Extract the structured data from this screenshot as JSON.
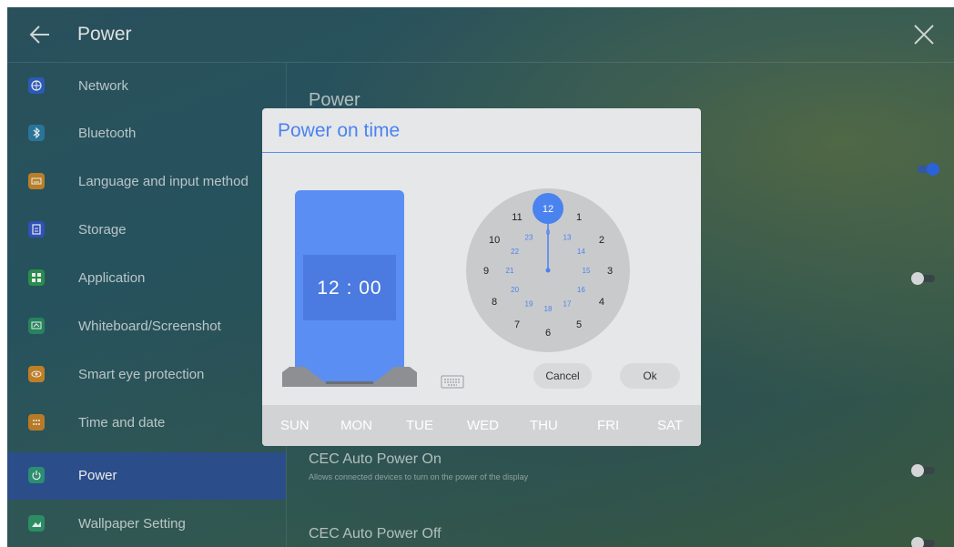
{
  "header": {
    "title": "Power",
    "back_icon": "back-arrow-icon",
    "close_icon": "close-icon"
  },
  "sidebar": {
    "items": [
      {
        "label": "Network",
        "icon": "globe-icon",
        "color": "#2f62c8"
      },
      {
        "label": "Bluetooth",
        "icon": "bluetooth-icon",
        "color": "#2d7fa6"
      },
      {
        "label": "Language and input method",
        "icon": "keyboard-icon",
        "color": "#c98a2c"
      },
      {
        "label": "Storage",
        "icon": "storage-icon",
        "color": "#3458c9"
      },
      {
        "label": "Application",
        "icon": "apps-grid-icon",
        "color": "#2f9a52"
      },
      {
        "label": "Whiteboard/Screenshot",
        "icon": "whiteboard-icon",
        "color": "#2a8f64"
      },
      {
        "label": "Smart eye protection",
        "icon": "eye-icon",
        "color": "#cf8a2a"
      },
      {
        "label": "Time and date",
        "icon": "calendar-icon",
        "color": "#c9852c"
      },
      {
        "label": "Power",
        "icon": "power-icon",
        "color": "#2f9b7a",
        "active": true
      },
      {
        "label": "Wallpaper Setting",
        "icon": "wallpaper-icon",
        "color": "#2e9a6c"
      }
    ]
  },
  "content": {
    "title": "Power",
    "rows": [
      {
        "title": "CEC Auto Power On",
        "desc": "Allows connected devices to turn on the power of the display",
        "toggle": false
      },
      {
        "title": "CEC Auto Power Off",
        "desc": "",
        "toggle": false
      }
    ],
    "toggles": [
      {
        "name": "toggle-1",
        "on": true
      },
      {
        "name": "toggle-2",
        "on": false
      },
      {
        "name": "toggle-cec-on",
        "on": false
      },
      {
        "name": "toggle-cec-off",
        "on": false
      }
    ]
  },
  "dialog": {
    "title": "Power on time",
    "time": "12 : 00",
    "clock": {
      "selected_hour": 12,
      "outer_hours": [
        "12",
        "1",
        "2",
        "3",
        "4",
        "5",
        "6",
        "7",
        "8",
        "9",
        "10",
        "11"
      ],
      "inner_hours": [
        "0",
        "13",
        "14",
        "15",
        "16",
        "17",
        "18",
        "19",
        "20",
        "21",
        "22",
        "23"
      ]
    },
    "cancel_label": "Cancel",
    "ok_label": "Ok",
    "days": [
      "SUN",
      "MON",
      "TUE",
      "WED",
      "THU",
      "FRI",
      "SAT"
    ],
    "accent": "#4a83ef"
  }
}
